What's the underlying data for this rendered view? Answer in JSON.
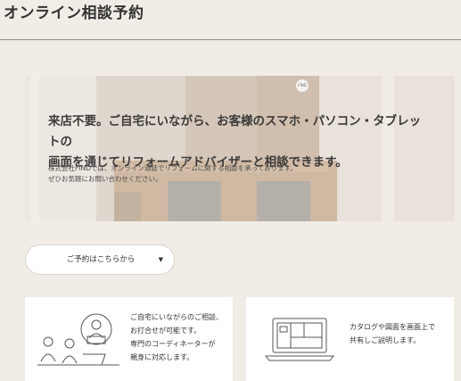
{
  "page": {
    "title": "オンライン相談予約"
  },
  "hero": {
    "headline_line1": "来店不要。ご自宅にいながら、お客様のスマホ・パソコン・タブレットの",
    "headline_line2": "画面を通じてリフォームアドバイザーと相談できます。",
    "sub_line1": "株式会社FINDでは、オンライン通話でリフォームに関する相談を承っております。",
    "sub_line2": "ぜひお気軽にお問い合わせください。",
    "badge_text": "FIND"
  },
  "reserve": {
    "label": "ご予約はこちらから",
    "caret": "▼"
  },
  "cards": [
    {
      "icon": "consultation-people-icon",
      "lines": [
        "ご自宅にいながらのご相談、",
        "お打合せが可能です。",
        "専門のコーディネーターが",
        "親身に対応します。"
      ]
    },
    {
      "icon": "laptop-floorplan-icon",
      "lines": [
        "カタログや図面を画面上で",
        "共有しご説明します。"
      ]
    }
  ],
  "colors": {
    "background": "#f1ece6",
    "card": "#ffffff",
    "text": "#333333"
  }
}
